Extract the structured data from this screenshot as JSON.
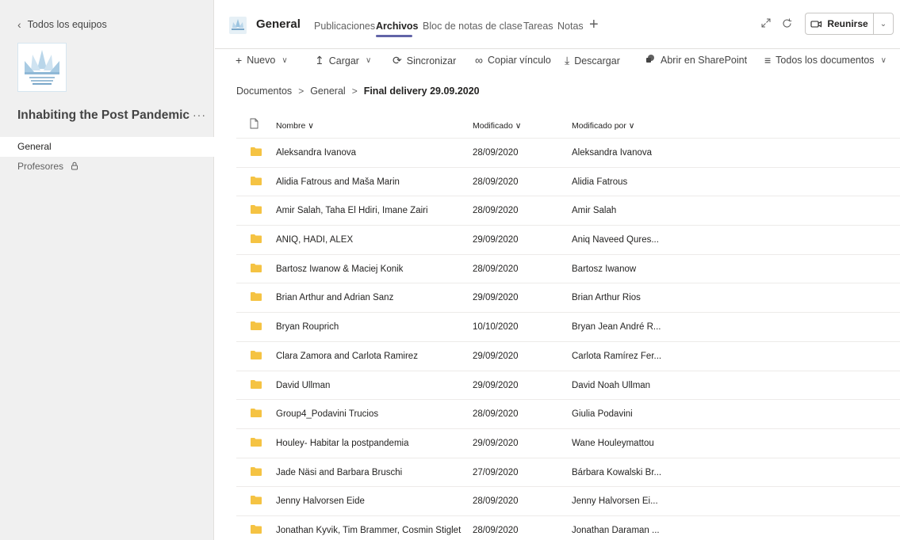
{
  "sidebar": {
    "back_label": "Todos los equipos",
    "team_name": "Inhabiting the Post Pandemic",
    "more": "···",
    "channels": [
      {
        "label": "General",
        "active": true
      },
      {
        "label": "Profesores",
        "active": false
      }
    ]
  },
  "header": {
    "channel_title": "General",
    "tabs": [
      {
        "label": "Publicaciones"
      },
      {
        "label": "Archivos"
      },
      {
        "label": "Bloc de notas de clase"
      },
      {
        "label": "Tareas"
      },
      {
        "label": "Notas"
      }
    ],
    "active_tab": "Archivos",
    "add_tab": "+",
    "meet_label": "Reunirse"
  },
  "toolbar": {
    "nuevo": "Nuevo",
    "cargar": "Cargar",
    "sincronizar": "Sincronizar",
    "copiar": "Copiar vínculo",
    "descargar": "Descargar",
    "sharepoint": "Abrir en SharePoint",
    "view": "Todos los documentos"
  },
  "breadcrumb": {
    "items": [
      "Documentos",
      "General"
    ],
    "current": "Final delivery 29.09.2020"
  },
  "table": {
    "columns": {
      "name": "Nombre",
      "modified": "Modificado",
      "modified_by": "Modificado por"
    },
    "rows": [
      {
        "name": "Aleksandra Ivanova",
        "modified": "28/09/2020",
        "modified_by": "Aleksandra Ivanova"
      },
      {
        "name": "Alidia Fatrous and Maša Marin",
        "modified": "28/09/2020",
        "modified_by": "Alidia Fatrous"
      },
      {
        "name": "Amir Salah, Taha El Hdiri, Imane Zairi",
        "modified": "28/09/2020",
        "modified_by": "Amir Salah"
      },
      {
        "name": "ANIQ, HADI, ALEX",
        "modified": "29/09/2020",
        "modified_by": "Aniq Naveed Qures..."
      },
      {
        "name": "Bartosz Iwanow & Maciej Konik",
        "modified": "28/09/2020",
        "modified_by": "Bartosz Iwanow"
      },
      {
        "name": "Brian Arthur and Adrian Sanz",
        "modified": "29/09/2020",
        "modified_by": "Brian Arthur Rios"
      },
      {
        "name": "Bryan Rouprich",
        "modified": "10/10/2020",
        "modified_by": "Bryan Jean André R..."
      },
      {
        "name": "Clara Zamora and Carlota Ramirez",
        "modified": "29/09/2020",
        "modified_by": "Carlota Ramírez Fer..."
      },
      {
        "name": "David Ullman",
        "modified": "29/09/2020",
        "modified_by": "David Noah Ullman"
      },
      {
        "name": "Group4_Podavini Trucios",
        "modified": "28/09/2020",
        "modified_by": "Giulia Podavini"
      },
      {
        "name": "Houley- Habitar la postpandemia",
        "modified": "29/09/2020",
        "modified_by": "Wane Houleymattou"
      },
      {
        "name": "Jade Näsi and Barbara Bruschi",
        "modified": "27/09/2020",
        "modified_by": "Bárbara Kowalski Br..."
      },
      {
        "name": "Jenny Halvorsen Eide",
        "modified": "28/09/2020",
        "modified_by": "Jenny Halvorsen Ei..."
      },
      {
        "name": "Jonathan Kyvik, Tim Brammer, Cosmin Stiglet",
        "modified": "28/09/2020",
        "modified_by": "Jonathan Daraman ..."
      }
    ]
  },
  "colors": {
    "accent": "#6264a7",
    "folder": "#f5c343",
    "sidebar_bg": "#f0f0f0"
  }
}
